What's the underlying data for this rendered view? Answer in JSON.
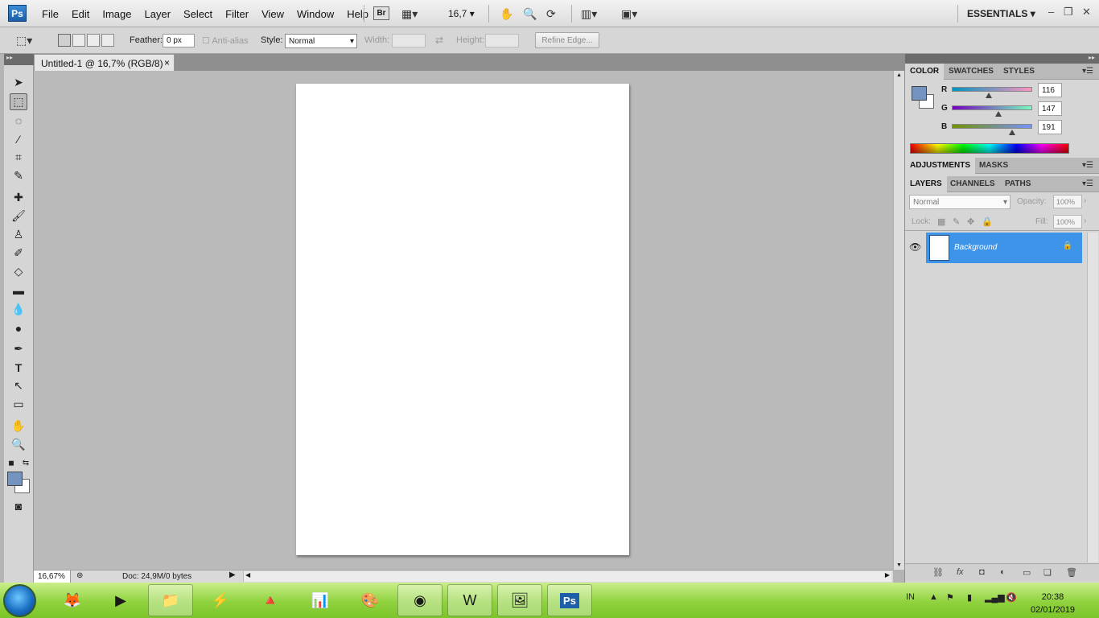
{
  "app": {
    "logo": "Ps",
    "workspace": "ESSENTIALS",
    "bridge_label": "Br",
    "zoom_selector": "16,7"
  },
  "menu": [
    "File",
    "Edit",
    "Image",
    "Layer",
    "Select",
    "Filter",
    "View",
    "Window",
    "Help"
  ],
  "options": {
    "feather_label": "Feather:",
    "feather_value": "0 px",
    "antialias_label": "Anti-alias",
    "style_label": "Style:",
    "style_value": "Normal",
    "width_label": "Width:",
    "height_label": "Height:",
    "refine_edge": "Refine Edge..."
  },
  "document": {
    "tab_title": "Untitled-1 @ 16,7% (RGB/8)",
    "close": "×"
  },
  "status": {
    "zoom": "16,67%",
    "doc_info": "Doc: 24,9M/0 bytes"
  },
  "colors": {
    "foreground": "#7493bf",
    "background": "#ffffff",
    "layer_selected": "#3e94e9"
  },
  "color_panel": {
    "tabs": [
      "COLOR",
      "SWATCHES",
      "STYLES"
    ],
    "channels": [
      {
        "label": "R",
        "value": "116",
        "level": 0.455
      },
      {
        "label": "G",
        "value": "147",
        "level": 0.576
      },
      {
        "label": "B",
        "value": "191",
        "level": 0.749
      }
    ]
  },
  "adjust_panel": {
    "tabs": [
      "ADJUSTMENTS",
      "MASKS"
    ]
  },
  "layers_panel": {
    "tabs": [
      "LAYERS",
      "CHANNELS",
      "PATHS"
    ],
    "blend_mode": "Normal",
    "opacity_label": "Opacity:",
    "opacity_value": "100%",
    "lock_label": "Lock:",
    "fill_label": "Fill:",
    "fill_value": "100%",
    "layers": [
      {
        "name": "Background",
        "visible": true,
        "locked": true
      }
    ]
  },
  "tools": [
    "move-tool",
    "marquee-tool",
    "lasso-tool",
    "quick-select-tool",
    "crop-tool",
    "eyedropper-tool",
    "healing-brush-tool",
    "brush-tool",
    "clone-stamp-tool",
    "history-brush-tool",
    "eraser-tool",
    "gradient-tool",
    "blur-tool",
    "dodge-tool",
    "pen-tool",
    "type-tool",
    "path-select-tool",
    "shape-tool",
    "hand-tool",
    "zoom-tool"
  ],
  "taskbar": {
    "language": "IN",
    "time": "20:38",
    "date": "02/01/2019",
    "items": [
      "firefox-icon",
      "media-player-icon",
      "file-explorer-icon",
      "winamp-icon",
      "vlc-icon",
      "powerpoint-icon",
      "paint-icon",
      "chrome-icon",
      "word-icon",
      "photo-viewer-icon",
      "photoshop-icon"
    ]
  }
}
